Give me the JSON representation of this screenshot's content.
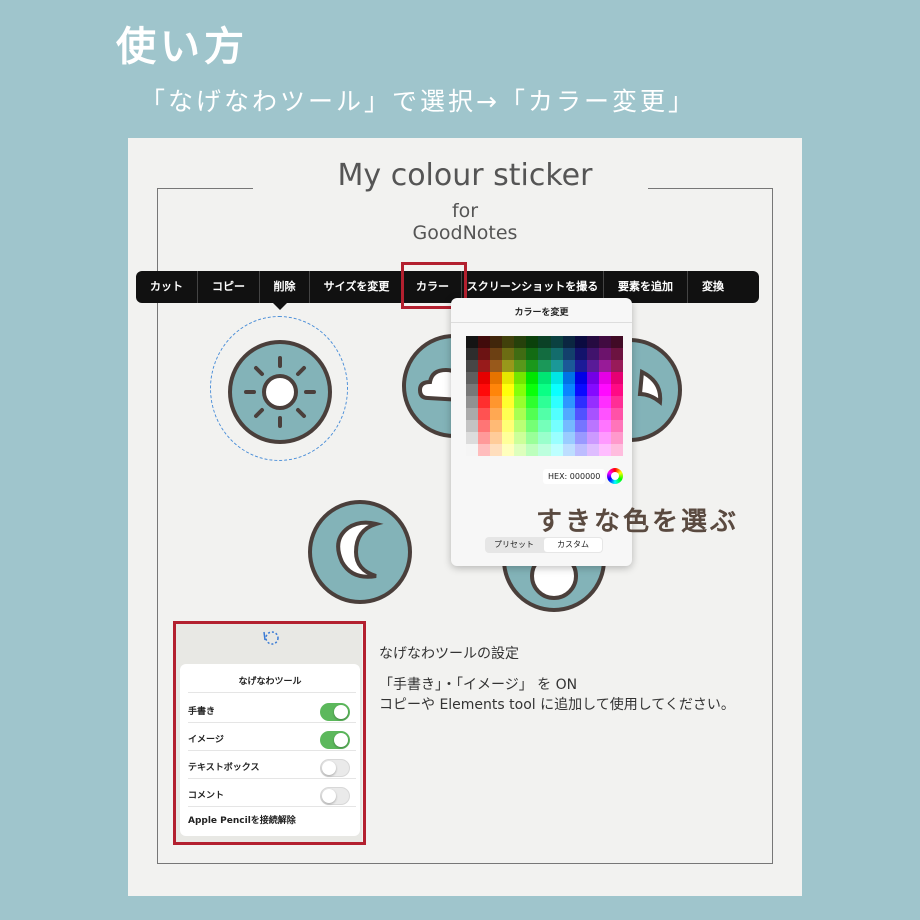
{
  "header": {
    "title": "使い方",
    "subtitle": "「なげなわツール」で選択→「カラー変更」"
  },
  "document": {
    "title": "My colour sticker",
    "for": "for",
    "app": "GoodNotes"
  },
  "context_menu": {
    "items": [
      "カット",
      "コピー",
      "削除",
      "サイズを変更",
      "カラー",
      "スクリーンショットを撮る",
      "要素を追加",
      "変換"
    ]
  },
  "color_popup": {
    "title": "カラーを変更",
    "hex_label": "HEX:",
    "hex_value": "000000",
    "tabs": [
      "プリセット",
      "カスタム"
    ],
    "active_tab": "カスタム"
  },
  "callout": {
    "choose_color": "すきな色を選ぶ"
  },
  "lasso_settings": {
    "title": "なげなわツール",
    "rows": [
      {
        "label": "手書き",
        "on": true
      },
      {
        "label": "イメージ",
        "on": true
      },
      {
        "label": "テキストボックス",
        "on": false
      },
      {
        "label": "コメント",
        "on": false
      }
    ],
    "footer": "Apple Pencilを接続解除"
  },
  "instructions": {
    "heading": "なげなわツールの設定",
    "line1": "「手書き」・「イメージ」 を ON",
    "line2": "コピーや Elements tool に追加して使用してください。"
  },
  "colors": {
    "background": "#9fc5cc",
    "sticker_fill": "#83b3b8",
    "sticker_outline": "#4a3f3b",
    "highlight_red": "#b3202f",
    "toggle_on": "#5cb85c"
  }
}
